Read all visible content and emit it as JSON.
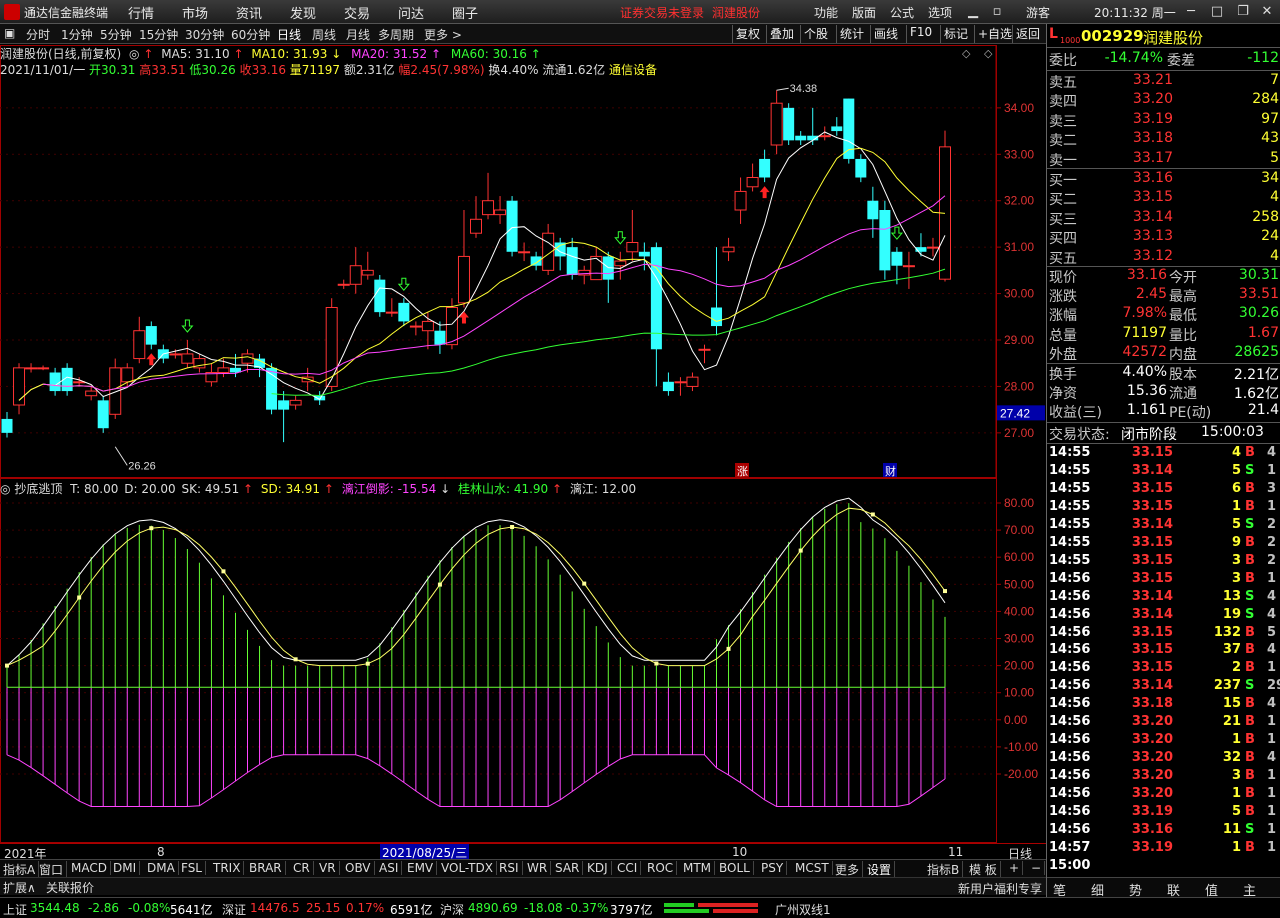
{
  "app": {
    "title": "通达信金融终端",
    "time": "20:11:32 周一",
    "guest": "游客"
  },
  "menu": [
    "行情",
    "市场",
    "资讯",
    "发现",
    "交易",
    "问达",
    "圈子"
  ],
  "warning": "证券交易未登录",
  "warning_stock": "润建股份",
  "right_menu": [
    "功能",
    "版面",
    "公式",
    "选项"
  ],
  "toolbar": {
    "periods": [
      "分时",
      "1分钟",
      "5分钟",
      "15分钟",
      "30分钟",
      "60分钟",
      "日线",
      "周线",
      "月线",
      "多周期",
      "更多 >"
    ],
    "active": "日线",
    "right": [
      "复权",
      "叠加",
      "个股",
      "统计",
      "画线",
      "F10",
      "标记",
      "+自选",
      "返回"
    ]
  },
  "main_info": {
    "name": "润建股份(日线,前复权)",
    "ma5": "MA5: 31.10",
    "ma10": "MA10: 31.93",
    "ma20": "MA20: 31.52",
    "ma60": "MA60: 30.16",
    "date": "2021/11/01/一",
    "open": "开30.31",
    "high": "高33.51",
    "low": "低30.26",
    "close": "收33.16",
    "vol": "量71197",
    "amount": "额2.31亿",
    "range": "幅2.45(7.98%)",
    "turnover": "换4.40%",
    "float": "流通1.62亿",
    "sector": "通信设备"
  },
  "price_axis": [
    "34.00",
    "33.00",
    "32.00",
    "31.00",
    "30.00",
    "29.00",
    "28.00",
    "27.00"
  ],
  "price_axis_current": "27.42",
  "annot_high": "34.38",
  "annot_low": "26.26",
  "markers": {
    "zhang": "涨",
    "cai": "财"
  },
  "ind_info": {
    "name": "抄底逃顶",
    "t": "T: 80.00",
    "d": "D: 20.00",
    "sk": "SK: 49.51",
    "sd": "SD: 34.91",
    "lijiang": "漓江倒影: -15.54",
    "guilin": "桂林山水: 41.90",
    "lj2": "漓江: 12.00"
  },
  "ind_axis": [
    "80.00",
    "70.00",
    "60.00",
    "50.00",
    "40.00",
    "30.00",
    "20.00",
    "10.00",
    "0.00",
    "-10.00",
    "-20.00"
  ],
  "x_axis": {
    "year": "2021年",
    "m8": "8",
    "date": "2021/08/25/三",
    "m10": "10",
    "m11": "11",
    "mode": "日线"
  },
  "bottom_tabs": [
    "指标A",
    "窗口",
    "MACD",
    "DMI",
    "DMA",
    "FSL",
    "TRIX",
    "BRAR",
    "CR",
    "VR",
    "OBV",
    "ASI",
    "EMV",
    "VOL-TDX",
    "RSI",
    "WR",
    "SAR",
    "KDJ",
    "CCI",
    "ROC",
    "MTM",
    "BOLL",
    "PSY",
    "MCST",
    "更多",
    "设置"
  ],
  "bottom_tab_active": "设置",
  "bottom_right": {
    "ib": "指标B",
    "mode": "模 板",
    "plus": "+",
    "minus": "−"
  },
  "expand": {
    "a": "扩展∧",
    "b": "关联报价",
    "promo": "新用户福利专享"
  },
  "panel": {
    "code": "002929",
    "name": "润建股份",
    "weibi_label": "委比",
    "weibi": "-14.74%",
    "weicha_label": "委差",
    "weicha": "-112",
    "asks": [
      {
        "label": "卖五",
        "price": "33.21",
        "vol": "7"
      },
      {
        "label": "卖四",
        "price": "33.20",
        "vol": "284"
      },
      {
        "label": "卖三",
        "price": "33.19",
        "vol": "97"
      },
      {
        "label": "卖二",
        "price": "33.18",
        "vol": "43"
      },
      {
        "label": "卖一",
        "price": "33.17",
        "vol": "5"
      }
    ],
    "bids": [
      {
        "label": "买一",
        "price": "33.16",
        "vol": "34"
      },
      {
        "label": "买二",
        "price": "33.15",
        "vol": "4"
      },
      {
        "label": "买三",
        "price": "33.14",
        "vol": "258"
      },
      {
        "label": "买四",
        "price": "33.13",
        "vol": "24"
      },
      {
        "label": "买五",
        "price": "33.12",
        "vol": "4"
      }
    ],
    "stats": [
      {
        "l1": "现价",
        "v1": "33.16",
        "c1": "red",
        "l2": "今开",
        "v2": "30.31",
        "c2": "green"
      },
      {
        "l1": "涨跌",
        "v1": "2.45",
        "c1": "red",
        "l2": "最高",
        "v2": "33.51",
        "c2": "red"
      },
      {
        "l1": "涨幅",
        "v1": "7.98%",
        "c1": "red",
        "l2": "最低",
        "v2": "30.26",
        "c2": "green"
      },
      {
        "l1": "总量",
        "v1": "71197",
        "c1": "yellow",
        "l2": "量比",
        "v2": "1.67",
        "c2": "red"
      },
      {
        "l1": "外盘",
        "v1": "42572",
        "c1": "red",
        "l2": "内盘",
        "v2": "28625",
        "c2": "green"
      }
    ],
    "stats2": [
      {
        "l1": "换手",
        "v1": "4.40%",
        "l2": "股本",
        "v2": "2.21亿"
      },
      {
        "l1": "净资",
        "v1": "15.36",
        "l2": "流通",
        "v2": "1.62亿"
      },
      {
        "l1": "收益(三)",
        "v1": "1.161",
        "l2": "PE(动)",
        "v2": "21.4"
      }
    ],
    "trade_status_label": "交易状态:",
    "trade_status": "闭市阶段",
    "trade_time": "15:00:03",
    "ticks": [
      {
        "t": "14:55",
        "p": "33.15",
        "v": "4",
        "s": "B",
        "n": "4"
      },
      {
        "t": "14:55",
        "p": "33.14",
        "v": "5",
        "s": "S",
        "n": "1"
      },
      {
        "t": "14:55",
        "p": "33.15",
        "v": "6",
        "s": "B",
        "n": "3"
      },
      {
        "t": "14:55",
        "p": "33.15",
        "v": "1",
        "s": "B",
        "n": "1"
      },
      {
        "t": "14:55",
        "p": "33.14",
        "v": "5",
        "s": "S",
        "n": "2"
      },
      {
        "t": "14:55",
        "p": "33.15",
        "v": "9",
        "s": "B",
        "n": "2"
      },
      {
        "t": "14:55",
        "p": "33.15",
        "v": "3",
        "s": "B",
        "n": "2"
      },
      {
        "t": "14:56",
        "p": "33.15",
        "v": "3",
        "s": "B",
        "n": "1"
      },
      {
        "t": "14:56",
        "p": "33.14",
        "v": "13",
        "s": "S",
        "n": "4"
      },
      {
        "t": "14:56",
        "p": "33.14",
        "v": "19",
        "s": "S",
        "n": "4"
      },
      {
        "t": "14:56",
        "p": "33.15",
        "v": "132",
        "s": "B",
        "n": "5"
      },
      {
        "t": "14:56",
        "p": "33.15",
        "v": "37",
        "s": "B",
        "n": "4"
      },
      {
        "t": "14:56",
        "p": "33.15",
        "v": "2",
        "s": "B",
        "n": "1"
      },
      {
        "t": "14:56",
        "p": "33.14",
        "v": "237",
        "s": "S",
        "n": "29"
      },
      {
        "t": "14:56",
        "p": "33.18",
        "v": "15",
        "s": "B",
        "n": "4"
      },
      {
        "t": "14:56",
        "p": "33.20",
        "v": "21",
        "s": "B",
        "n": "1"
      },
      {
        "t": "14:56",
        "p": "33.20",
        "v": "1",
        "s": "B",
        "n": "1"
      },
      {
        "t": "14:56",
        "p": "33.20",
        "v": "32",
        "s": "B",
        "n": "4"
      },
      {
        "t": "14:56",
        "p": "33.20",
        "v": "3",
        "s": "B",
        "n": "1"
      },
      {
        "t": "14:56",
        "p": "33.20",
        "v": "1",
        "s": "B",
        "n": "1"
      },
      {
        "t": "14:56",
        "p": "33.19",
        "v": "5",
        "s": "B",
        "n": "1"
      },
      {
        "t": "14:56",
        "p": "33.16",
        "v": "11",
        "s": "S",
        "n": "1"
      },
      {
        "t": "14:57",
        "p": "33.19",
        "v": "1",
        "s": "B",
        "n": "1"
      }
    ],
    "last_time": "15:00",
    "footer_tabs": [
      "笔",
      "细",
      "势",
      "联",
      "值",
      "主"
    ]
  },
  "status": {
    "sh_label": "上证",
    "sh_val": "3544.48",
    "sh_chg": "-2.86",
    "sh_pct": "-0.08%",
    "sh_amt": "5641亿",
    "sz_label": "深证",
    "sz_val": "14476.5",
    "sz_chg": "25.15",
    "sz_pct": "0.17%",
    "sz_amt": "6591亿",
    "hs_label": "沪深",
    "hs_val": "4890.69",
    "hs_chg": "-18.08",
    "hs_pct": "-0.37%",
    "hs_amt": "3797亿",
    "line": "广州双线1"
  },
  "chart_data": {
    "type": "candlestick",
    "price_range": [
      26.2,
      34.6
    ],
    "candles": [
      [
        27.3,
        27.0,
        27.45,
        26.9
      ],
      [
        27.6,
        28.4,
        28.5,
        27.4
      ],
      [
        28.4,
        28.4,
        28.5,
        28.3
      ],
      [
        28.4,
        28.4,
        28.45,
        28.35
      ],
      [
        28.3,
        27.9,
        28.4,
        27.8
      ],
      [
        28.4,
        27.9,
        28.5,
        27.8
      ],
      [
        28.1,
        28.1,
        28.2,
        28.0
      ],
      [
        27.8,
        27.9,
        28.0,
        27.7
      ],
      [
        27.7,
        27.1,
        27.8,
        27.0
      ],
      [
        27.4,
        28.4,
        28.6,
        27.3
      ],
      [
        28.1,
        28.4,
        28.5,
        28.0
      ],
      [
        28.6,
        29.2,
        29.5,
        28.5
      ],
      [
        29.3,
        28.9,
        29.4,
        28.8
      ],
      [
        28.8,
        28.6,
        28.9,
        28.5
      ],
      [
        28.7,
        28.7,
        28.8,
        28.6
      ],
      [
        28.5,
        28.7,
        29.0,
        28.4
      ],
      [
        28.4,
        28.6,
        28.7,
        28.3
      ],
      [
        28.1,
        28.3,
        28.5,
        28.0
      ],
      [
        28.3,
        28.4,
        28.6,
        28.2
      ],
      [
        28.4,
        28.3,
        28.7,
        28.2
      ],
      [
        28.5,
        28.7,
        28.8,
        28.3
      ],
      [
        28.6,
        28.4,
        28.7,
        28.2
      ],
      [
        28.4,
        27.5,
        28.5,
        27.4
      ],
      [
        27.7,
        27.5,
        27.9,
        26.8
      ],
      [
        27.6,
        27.7,
        27.8,
        27.5
      ],
      [
        28.1,
        28.2,
        28.4,
        27.9
      ],
      [
        27.8,
        27.7,
        27.9,
        27.6
      ],
      [
        28.0,
        29.7,
        29.9,
        27.9
      ],
      [
        30.2,
        30.2,
        30.3,
        30.1
      ],
      [
        30.2,
        30.6,
        31.0,
        30.0
      ],
      [
        30.4,
        30.5,
        30.9,
        30.3
      ],
      [
        30.3,
        29.6,
        30.4,
        29.5
      ],
      [
        29.6,
        29.6,
        29.9,
        29.5
      ],
      [
        29.8,
        29.4,
        29.9,
        29.3
      ],
      [
        29.3,
        29.3,
        29.4,
        29.1
      ],
      [
        29.2,
        29.4,
        29.6,
        28.8
      ],
      [
        29.2,
        28.9,
        29.4,
        28.7
      ],
      [
        28.9,
        29.7,
        29.9,
        28.8
      ],
      [
        29.8,
        30.8,
        31.8,
        29.7
      ],
      [
        31.3,
        31.6,
        32.1,
        31.2
      ],
      [
        31.7,
        32.0,
        32.6,
        31.6
      ],
      [
        31.7,
        31.8,
        32.1,
        31.5
      ],
      [
        32.0,
        30.9,
        32.1,
        30.8
      ],
      [
        30.9,
        30.9,
        31.1,
        30.7
      ],
      [
        30.8,
        30.6,
        30.9,
        30.5
      ],
      [
        30.5,
        31.3,
        31.5,
        30.4
      ],
      [
        31.1,
        30.8,
        31.2,
        30.5
      ],
      [
        31.0,
        30.4,
        31.2,
        30.3
      ],
      [
        30.4,
        30.5,
        30.6,
        30.2
      ],
      [
        30.3,
        30.8,
        31.0,
        30.3
      ],
      [
        30.8,
        30.3,
        30.9,
        29.8
      ],
      [
        30.6,
        30.7,
        30.9,
        30.3
      ],
      [
        30.9,
        31.1,
        31.8,
        30.7
      ],
      [
        30.9,
        30.8,
        31.1,
        30.5
      ],
      [
        31.0,
        28.8,
        31.1,
        28.0
      ],
      [
        28.1,
        27.9,
        28.3,
        27.8
      ],
      [
        28.1,
        28.1,
        28.2,
        27.8
      ],
      [
        28.0,
        28.2,
        28.3,
        27.9
      ],
      [
        28.8,
        28.8,
        28.9,
        28.5
      ],
      [
        29.7,
        29.3,
        31.0,
        29.1
      ],
      [
        30.9,
        31.0,
        31.2,
        30.7
      ],
      [
        31.8,
        32.2,
        32.5,
        31.5
      ],
      [
        32.3,
        32.5,
        32.8,
        32.2
      ],
      [
        32.9,
        32.5,
        33.1,
        32.4
      ],
      [
        33.2,
        34.1,
        34.38,
        33.0
      ],
      [
        34.0,
        33.3,
        34.1,
        33.2
      ],
      [
        33.4,
        33.3,
        33.5,
        33.2
      ],
      [
        33.4,
        33.3,
        34.0,
        33.2
      ],
      [
        33.4,
        33.4,
        33.6,
        33.3
      ],
      [
        33.6,
        33.5,
        33.8,
        33.4
      ],
      [
        34.2,
        32.9,
        34.2,
        32.8
      ],
      [
        32.9,
        32.5,
        33.0,
        32.4
      ],
      [
        32.0,
        31.6,
        32.3,
        31.2
      ],
      [
        31.8,
        30.5,
        32.0,
        30.3
      ],
      [
        30.9,
        30.6,
        31.0,
        30.2
      ],
      [
        30.6,
        30.6,
        30.9,
        30.1
      ],
      [
        31.0,
        30.9,
        31.3,
        30.8
      ],
      [
        31.0,
        31.0,
        31.2,
        30.8
      ],
      [
        30.31,
        33.16,
        33.51,
        30.26
      ]
    ]
  }
}
